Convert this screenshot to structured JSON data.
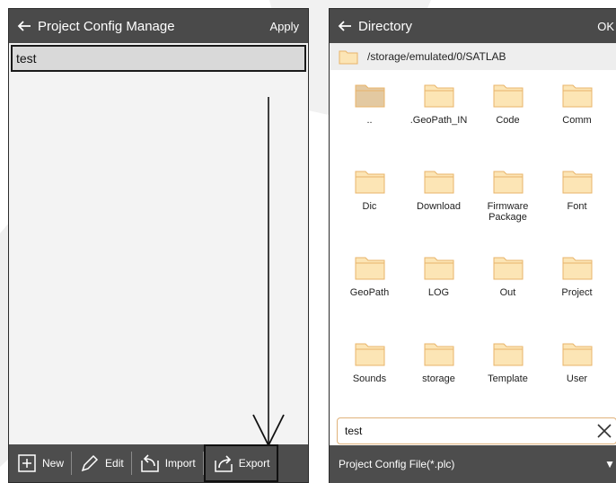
{
  "left": {
    "title": "Project Config Manage",
    "action": "Apply",
    "items": [
      "test"
    ],
    "toolbar": {
      "new_label": "New",
      "edit_label": "Edit",
      "import_label": "Import",
      "export_label": "Export"
    }
  },
  "right": {
    "title": "Directory",
    "action": "OK",
    "path": "/storage/emulated/0/SATLAB",
    "folders": [
      "..",
      ".GeoPath_IN",
      "Code",
      "Comm",
      "Dic",
      "Download",
      "Firmware Package",
      "Font",
      "GeoPath",
      "LOG",
      "Out",
      "Project",
      "Sounds",
      "storage",
      "Template",
      "User"
    ],
    "filename_value": "test",
    "file_type": "Project Config File(*.plc)"
  },
  "colors": {
    "titlebar": "#4a4a4a",
    "folder": "#fce5b5",
    "folder_border": "#e8b46a",
    "selection": "#1a1a1a"
  },
  "icons": [
    "back-arrow-icon",
    "folder-icon",
    "plus-icon",
    "pencil-icon",
    "import-icon",
    "export-icon",
    "close-icon",
    "down-arrow-icon"
  ]
}
